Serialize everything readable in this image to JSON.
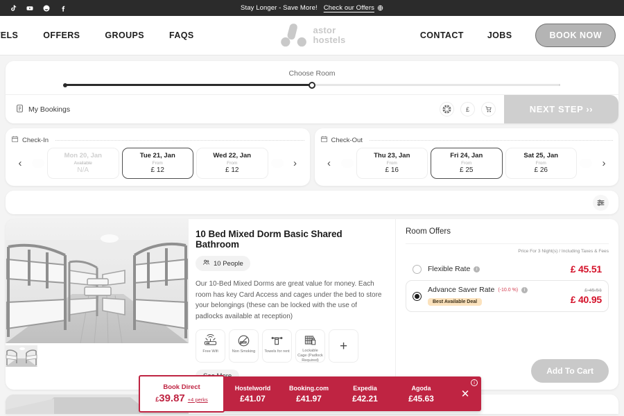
{
  "topbar": {
    "social": [
      {
        "name": "tiktok-icon",
        "label": "TikTok"
      },
      {
        "name": "youtube-icon",
        "label": "YouTube"
      },
      {
        "name": "instagram-icon",
        "label": "Instagram"
      },
      {
        "name": "facebook-icon",
        "label": "Facebook"
      }
    ],
    "message": "Stay Longer - Save More!",
    "offer_link": "Check our Offers",
    "bg_color": "#2b2b2b"
  },
  "nav": {
    "left_items": [
      "STELS",
      "OFFERS",
      "GROUPS",
      "FAQS"
    ],
    "right_items": [
      "CONTACT",
      "JOBS"
    ],
    "book_now": "BOOK NOW",
    "brand_line1": "astor",
    "brand_line2": "hostels"
  },
  "stepper": {
    "current_step": "Choose Room",
    "progress_percent": 50,
    "my_bookings": "My Bookings",
    "language": "EN",
    "currency": "£",
    "next_step": "NEXT STEP  ››"
  },
  "checkin": {
    "label": "Check-In",
    "prev_arrow": "‹",
    "next_arrow": "›",
    "dates": [
      {
        "day": "Mon 20, Jan",
        "sub": "Available",
        "price": "N/A",
        "state": "disabled"
      },
      {
        "day": "Tue 21, Jan",
        "sub": "From",
        "price": "£ 12",
        "state": "selected"
      },
      {
        "day": "Wed 22, Jan",
        "sub": "From",
        "price": "£ 12",
        "state": "normal"
      }
    ]
  },
  "checkout": {
    "label": "Check-Out",
    "prev_arrow": "‹",
    "next_arrow": "›",
    "dates": [
      {
        "day": "Thu 23, Jan",
        "sub": "From",
        "price": "£ 16",
        "state": "normal"
      },
      {
        "day": "Fri 24, Jan",
        "sub": "From",
        "price": "£ 25",
        "state": "selected"
      },
      {
        "day": "Sat 25, Jan",
        "sub": "From",
        "price": "£ 26",
        "state": "normal"
      }
    ]
  },
  "filters": {
    "icon": "sliders-icon"
  },
  "room": {
    "title": "10 Bed Mixed Dorm Basic Shared Bathroom",
    "capacity": "10 People",
    "description": "Our 10-Bed Mixed Dorms are great value for money. Each room has key Card Access and cages under the bed to store your belongings (these can be locked with the use of padlocks available at reception)",
    "amenities": [
      {
        "icon": "wifi-router-icon",
        "label": "Free Wifi"
      },
      {
        "icon": "no-smoking-icon",
        "label": "Non Smoking"
      },
      {
        "icon": "towel-icon",
        "label": "Towels for rent"
      },
      {
        "icon": "lockable-cage-icon",
        "label": "Lockable Cage (Padlock Required)"
      }
    ],
    "more_amenities": "+",
    "see_more": "See More"
  },
  "offers": {
    "title": "Room Offers",
    "price_note": "Price For 3 Night(s) / Including Taxes & Fees",
    "rates": [
      {
        "name": "Flexible Rate",
        "discount": "",
        "badge": "",
        "old_price": "",
        "price": "£ 45.51",
        "selected": false
      },
      {
        "name": "Advance Saver Rate",
        "discount": "(-10.0 %)",
        "badge": "Best Available Deal",
        "old_price": "£ 45.51",
        "price": "£ 40.95",
        "selected": true
      }
    ],
    "add_to_cart": "Add To Cart"
  },
  "compare": {
    "direct_label": "Book Direct",
    "direct_currency": "£",
    "direct_price": "39.87",
    "perks": "+4 perks",
    "providers": [
      {
        "name": "Hostelworld",
        "price": "£41.07"
      },
      {
        "name": "Booking.com",
        "price": "£41.97"
      },
      {
        "name": "Expedia",
        "price": "£42.21"
      },
      {
        "name": "Agoda",
        "price": "£45.63"
      }
    ],
    "close": "✕",
    "info": "i",
    "bg_color": "#bf2442"
  }
}
